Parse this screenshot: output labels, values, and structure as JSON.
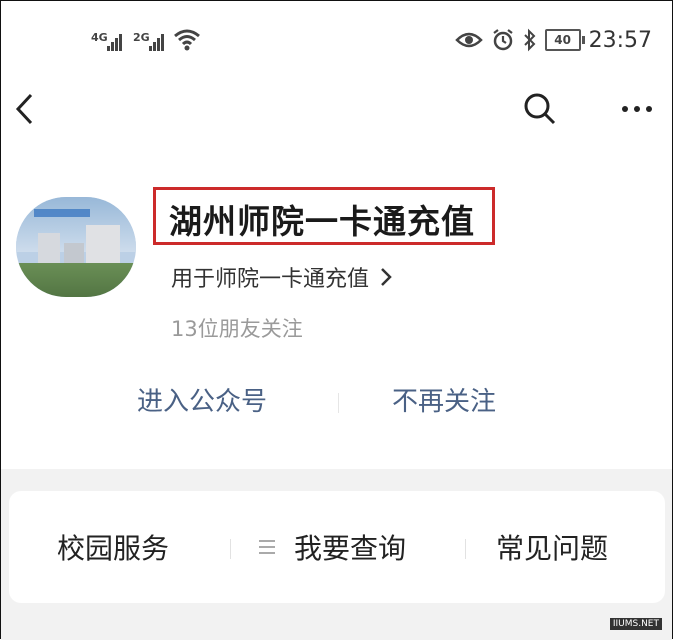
{
  "status_bar": {
    "signal1_label": "4G",
    "signal2_label": "2G",
    "battery": "40",
    "time": "23:57",
    "icons": [
      "signal-icon",
      "wifi-icon",
      "eye-icon",
      "alarm-icon",
      "bluetooth-icon",
      "battery-icon"
    ]
  },
  "nav": {
    "back_icon": "back-icon",
    "search_icon": "search-icon",
    "more_icon": "more-icon"
  },
  "profile": {
    "title": "湖州师院一卡通充值",
    "description": "用于师院一卡通充值",
    "followers": "13位朋友关注",
    "highlight_color": "#cc2a2a"
  },
  "actions": {
    "enter": "进入公众号",
    "unfollow": "不再关注"
  },
  "menu": {
    "items": [
      "校园服务",
      "我要查询",
      "常见问题"
    ],
    "menu_icon": "list-icon"
  },
  "watermark": "IIUMS.NET"
}
